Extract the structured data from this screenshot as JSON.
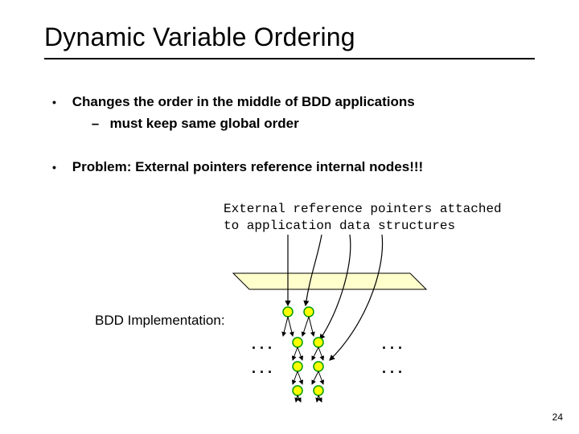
{
  "title": "Dynamic Variable Ordering",
  "bullets": {
    "b1": {
      "main": "Changes the order in the middle of BDD applications",
      "sub": "must keep same global order"
    },
    "b2": {
      "main": "Problem: External pointers reference internal nodes!!!"
    }
  },
  "caption": {
    "line1": "External reference pointers attached",
    "line2": "to application data structures"
  },
  "impl_label": "BDD Implementation:",
  "ellipsis": ". . .",
  "page_number": "24",
  "diagram": {
    "planeFill": "#FFFFCC",
    "planeStroke": "#000000",
    "nodeFill": "#FFFF00",
    "nodeStroke": "#009900",
    "arrowColor": "#000000"
  }
}
